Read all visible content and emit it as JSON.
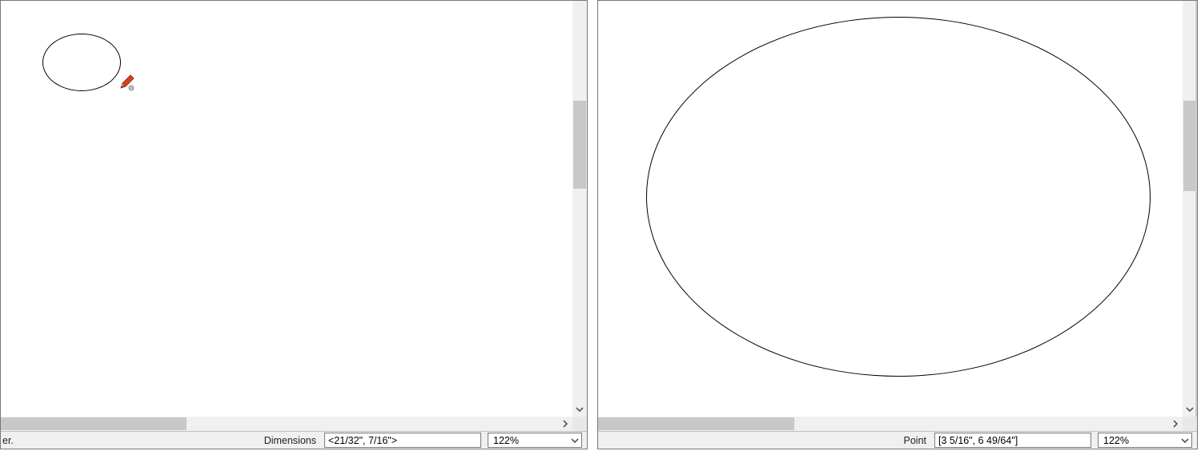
{
  "left": {
    "status_prefix": "er.",
    "status_label": "Dimensions",
    "dim_value": "<21/32\", 7/16\">",
    "zoom": "122%"
  },
  "right": {
    "status_label": "Point",
    "dim_value": "[3 5/16\", 6 49/64\"]",
    "zoom": "122%"
  },
  "icons": {
    "pencil": "pencil-cursor"
  }
}
